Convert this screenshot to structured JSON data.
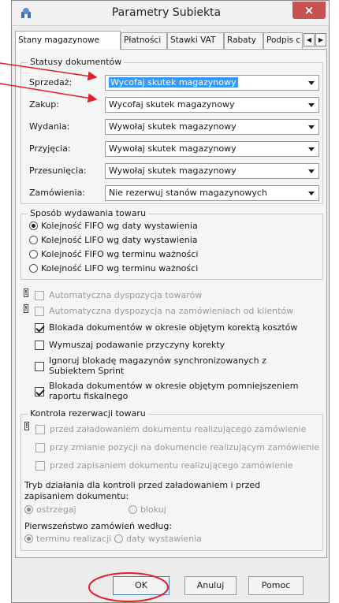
{
  "window": {
    "title": "Parametry Subiekta",
    "close_label": "×"
  },
  "tabs": [
    {
      "label": "Stany magazynowe",
      "active": true
    },
    {
      "label": "Płatności"
    },
    {
      "label": "Stawki VAT"
    },
    {
      "label": "Rabaty"
    },
    {
      "label": "Podpis c"
    }
  ],
  "tab_scroll": {
    "left": "◀",
    "right": "▶"
  },
  "statusy": {
    "legend": "Statusy dokumentów",
    "rows": [
      {
        "label": "Sprzedaż:",
        "value": "Wycofaj skutek magazynowy"
      },
      {
        "label": "Zakup:",
        "value": "Wycofaj skutek magazynowy"
      },
      {
        "label": "Wydania:",
        "value": "Wywołaj skutek magazynowy"
      },
      {
        "label": "Przyjęcia:",
        "value": "Wywołaj skutek magazynowy"
      },
      {
        "label": "Przesunięcia:",
        "value": "Wywołaj skutek magazynowy"
      },
      {
        "label": "Zamówienia:",
        "value": "Nie rezerwuj stanów magazynowych"
      }
    ]
  },
  "sposob": {
    "legend": "Sposób wydawania towaru",
    "options": [
      "Kolejność FIFO wg daty wystawienia",
      "Kolejność LIFO wg daty wystawienia",
      "Kolejność FIFO wg terminu ważności",
      "Kolejność LIFO wg terminu ważności"
    ],
    "selected_index": 0
  },
  "checkboxes": [
    {
      "label": "Automatyczna dyspozycja towarów",
      "checked": false,
      "disabled": true
    },
    {
      "label": "Automatyczna dyspozycja na zamówieniach od klientów",
      "checked": false,
      "disabled": true
    },
    {
      "label": "Blokada dokumentów w okresie objętym korektą kosztów",
      "checked": true,
      "disabled": false
    },
    {
      "label": "Wymuszaj podawanie przyczyny korekty",
      "checked": false,
      "disabled": false
    },
    {
      "label": "Ignoruj blokadę magazynów synchronizowanych z",
      "label2": "Subiektem Sprint",
      "checked": false,
      "disabled": false
    },
    {
      "label": "Blokada dokumentów w okresie objętym pomniejszeniem",
      "label2": "raportu fiskalnego",
      "checked": true,
      "disabled": false
    }
  ],
  "kontrola": {
    "legend": "Kontrola rezerwacji towaru",
    "checkboxes": [
      {
        "label": "przed załadowaniem dokumentu realizującego zamówienie"
      },
      {
        "label": "przy zmianie pozycji na dokumencie realizującym zamówienie"
      },
      {
        "label": "przed zapisaniem dokumentu realizującego zamówienie"
      }
    ],
    "tryb_label1": "Tryb działania dla kontroli przed załadowaniem i przed",
    "tryb_label2": "zapisaniem dokumentu:",
    "tryb_options": [
      "ostrzegaj",
      "blokuj"
    ],
    "tryb_selected": 0,
    "pierwsz_label": "Pierwszeństwo zamówień według:",
    "pierwsz_options": [
      "terminu realizacji",
      "daty wystawienia"
    ],
    "pierwsz_selected": 0
  },
  "buttons": {
    "ok": "OK",
    "cancel": "Anuluj",
    "help": "Pomoc"
  },
  "colors": {
    "highlight": "#3399ff",
    "annotation_red": "#e0202a",
    "close_button": "#c75050"
  }
}
